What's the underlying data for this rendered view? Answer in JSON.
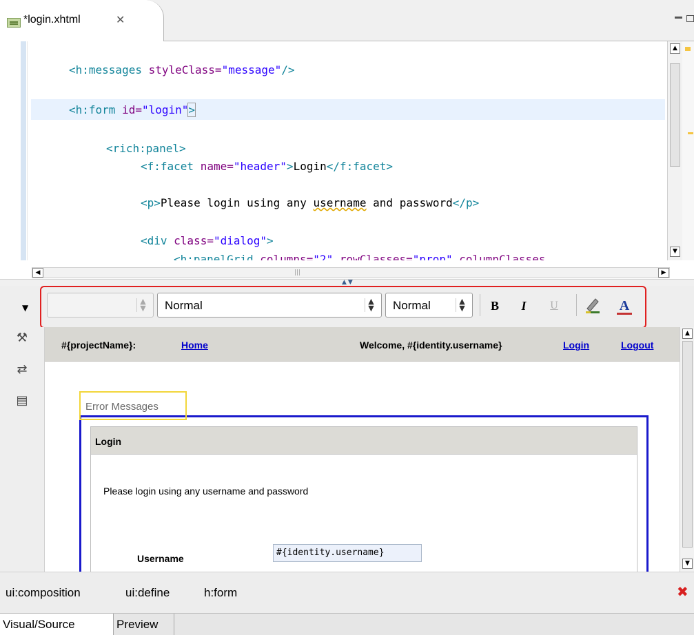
{
  "editor_tab": {
    "label": "*login.xhtml",
    "close_glyph": "✕"
  },
  "source": {
    "line1": {
      "tag": "<h:messages",
      "attr": " styleClass=",
      "val": "\"message\"",
      "end": "/>"
    },
    "line2": {
      "tag": "<h:form",
      "attr": " id=",
      "val": "\"login\"",
      "end": ">"
    },
    "line3": {
      "tag": "<rich:panel>"
    },
    "line4": {
      "tag": "<f:facet",
      "attr": " name=",
      "val": "\"header\"",
      "close": ">",
      "text": "Login",
      "end": "</f:facet>"
    },
    "line5": {
      "tag": "<p>",
      "text_a": "Please login using any ",
      "text_b": "username",
      "text_c": " and password",
      "end": "</p>"
    },
    "line6": {
      "tag": "<div",
      "attr": " class=",
      "val": "\"dialog\"",
      "end": ">"
    },
    "line7": {
      "tag": "<h:panelGrid",
      "attr": " columns=",
      "val": "\"2\"",
      "attr2": " rowClasses=",
      "val2": "\"prop\"",
      "attr3": " columnClasses"
    }
  },
  "toolbar": {
    "font_value": "",
    "format_value": "Normal",
    "size_value": "Normal",
    "bold": "B",
    "italic": "I",
    "underline": "U",
    "text_color": "A"
  },
  "visual": {
    "navbar": {
      "project": "#{projectName}:",
      "home": "Home",
      "welcome": "Welcome, #{identity.username}",
      "login": "Login",
      "logout": "Logout"
    },
    "error_messages": "Error Messages",
    "panel_header": "Login",
    "panel_text": "Please login using any username and password",
    "username_label": "Username",
    "username_value": "#{identity.username}"
  },
  "breadcrumb": {
    "items": [
      "ui:composition",
      "ui:define",
      "h:form"
    ]
  },
  "bottom_tabs": {
    "visual_source": "Visual/Source",
    "preview": "Preview"
  },
  "colors": {
    "selection_frame": "#e02020",
    "form_border": "#1a1acc",
    "messages_border": "#f2d63a",
    "link": "#0000cc"
  }
}
